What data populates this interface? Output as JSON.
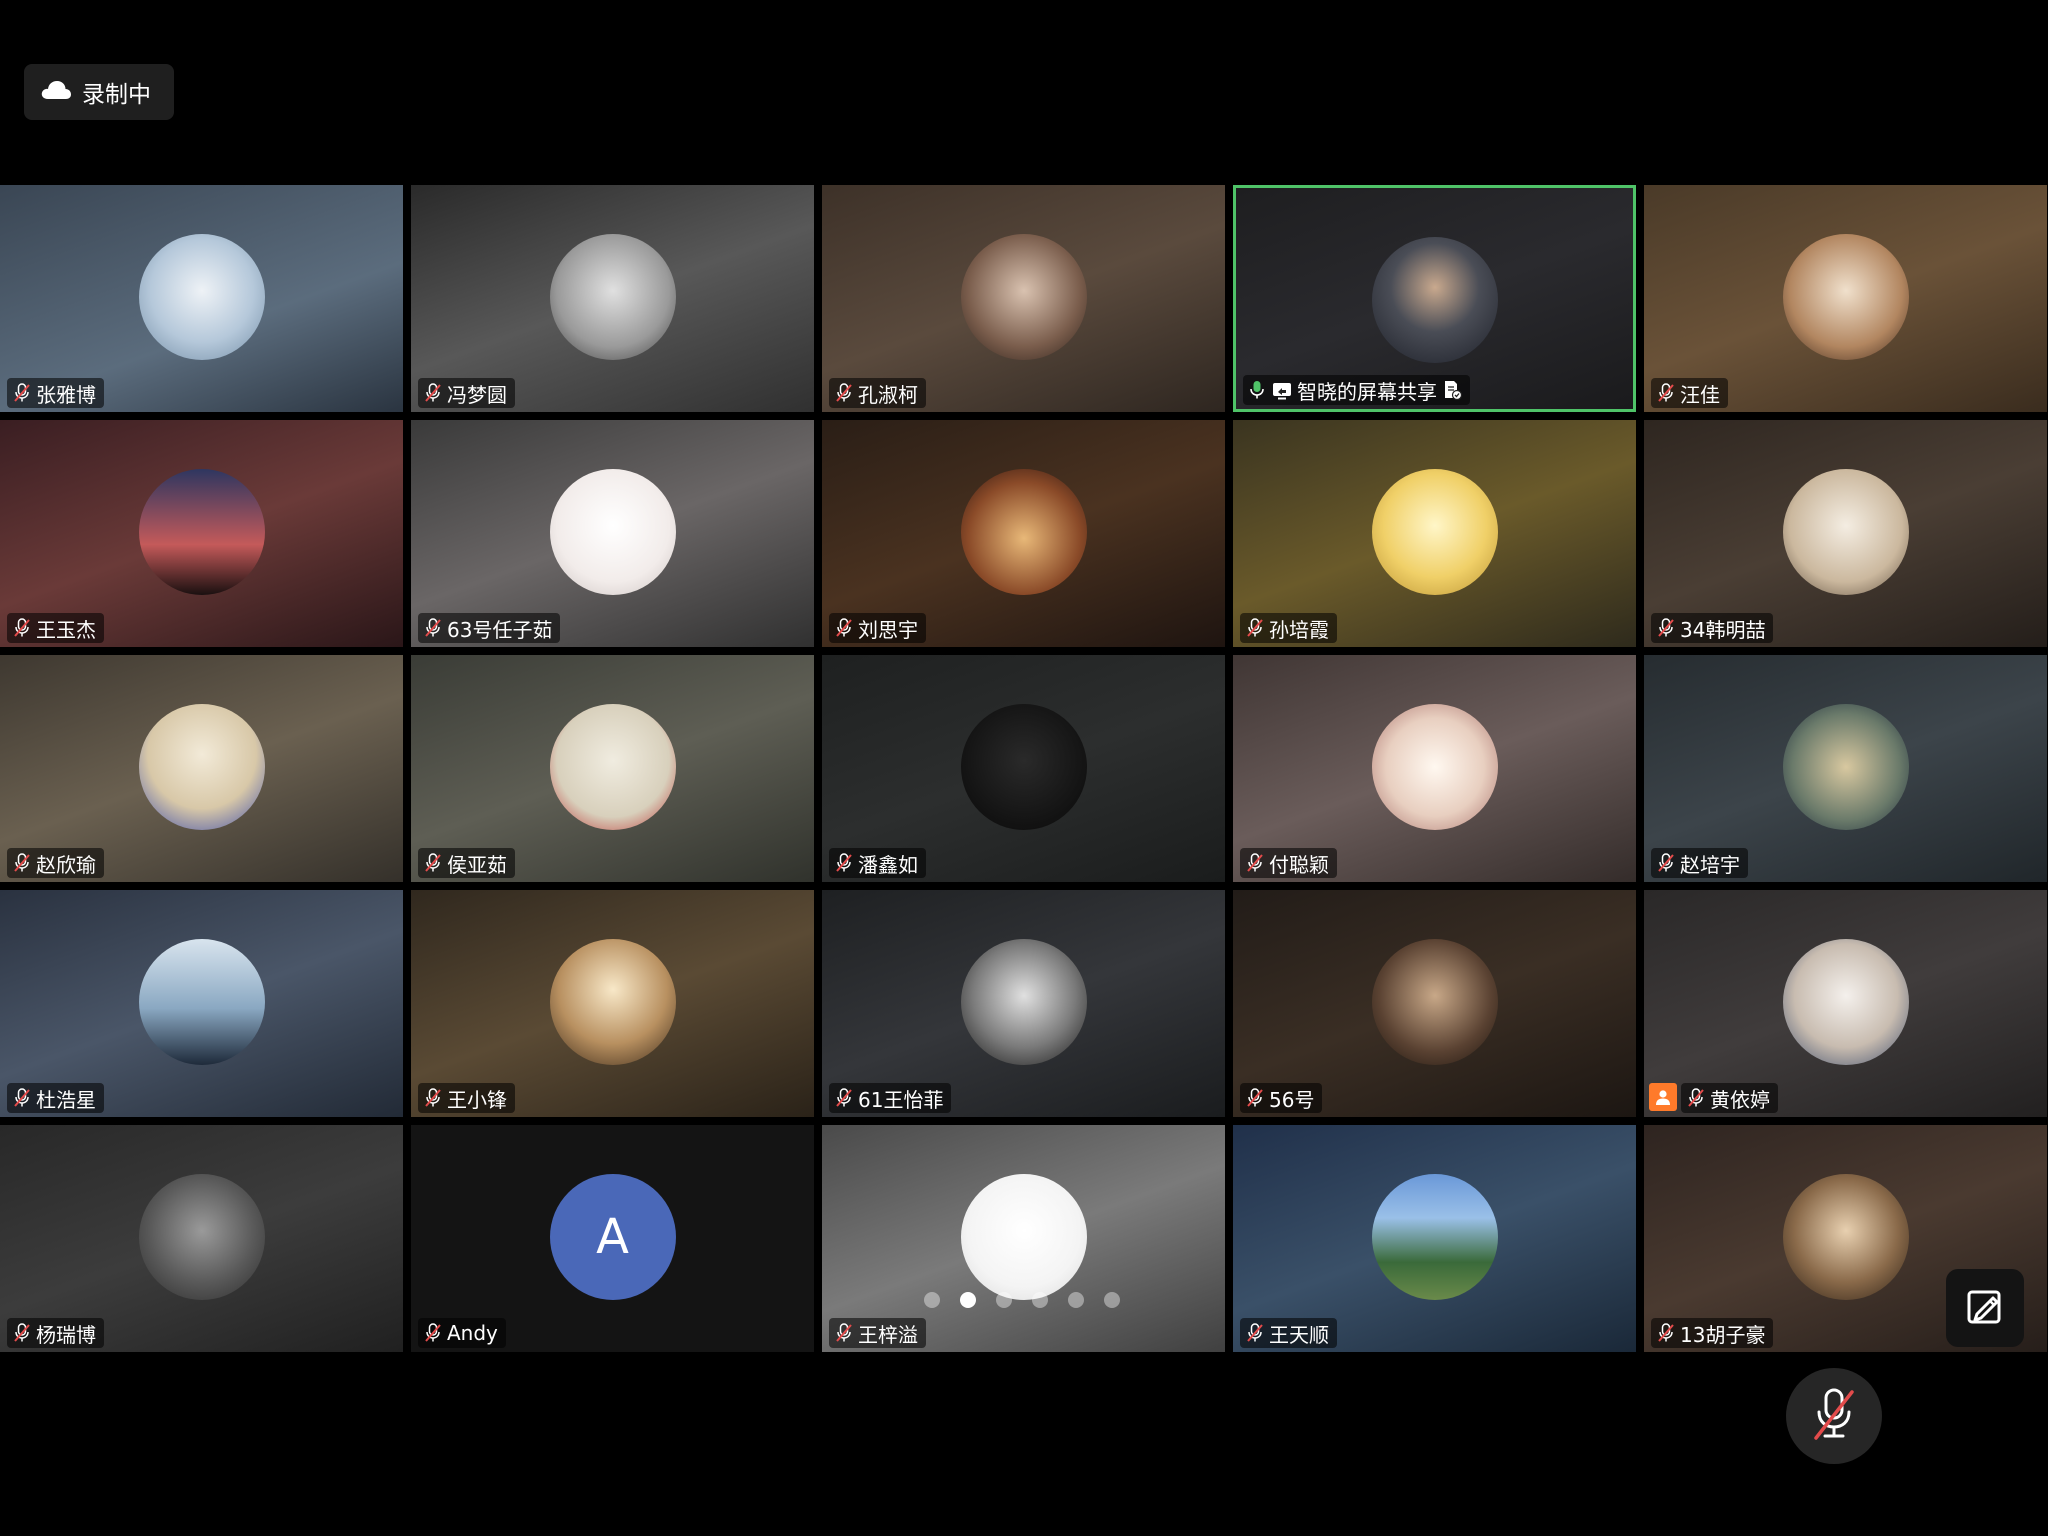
{
  "recording": {
    "label": "录制中",
    "icon": "cloud-icon"
  },
  "tiles": [
    {
      "name": "张雅博",
      "mic": "muted",
      "bg": "linear-gradient(160deg,#3a4654 0%,#5b6c7d 60%,#2a3440 100%)",
      "avatar": "radial-gradient(circle at 50% 45%,#eef2f6 0%,#b5c8da 55%,#6f8aa3 100%)"
    },
    {
      "name": "冯梦圆",
      "mic": "muted",
      "bg": "linear-gradient(160deg,#2a2a2a 0%,#585858 50%,#303030 100%)",
      "avatar": "radial-gradient(circle at 50% 45%,#e0e0e0 0%,#9a9a9a 60%,#3a3a3a 100%)"
    },
    {
      "name": "孔淑柯",
      "mic": "muted",
      "bg": "linear-gradient(160deg,#3d3128 0%,#5a4a3d 50%,#2e2620 100%)",
      "avatar": "radial-gradient(circle at 50% 45%,#d9c2b0 0%,#7a5d4c 60%,#2a1e18 100%)"
    },
    {
      "name": "智晓的屏幕共享",
      "mic": "active",
      "screen_share": true,
      "doc_icon": true,
      "active": true,
      "bg": "linear-gradient(160deg,#1e1e20 0%,#2a2a2e 50%,#1a1a1c 100%)",
      "avatar": "radial-gradient(circle at 50% 40%,#c9a98e 0%,#4a4d56 45%,#1c1f28 100%)"
    },
    {
      "name": "汪佳",
      "mic": "muted",
      "bg": "linear-gradient(160deg,#4a3a28 0%,#6a5238 50%,#3a2c1e 100%)",
      "avatar": "radial-gradient(circle at 50% 45%,#f0e0cc 0%,#b28660 60%,#3a2418 100%)"
    },
    {
      "name": "王玉杰",
      "mic": "muted",
      "bg": "linear-gradient(160deg,#3a1e22 0%,#6a3a38 50%,#2a1618 100%)",
      "avatar": "linear-gradient(180deg,#2e3660 0%,#c45a5a 60%,#1a1010 100%)"
    },
    {
      "name": "63号任子茹",
      "mic": "muted",
      "bg": "linear-gradient(160deg,#3a3a3a 0%,#6a6666 50%,#303030 100%)",
      "avatar": "radial-gradient(circle at 50% 45%,#ffffff 0%,#f2ecea 60%,#c9c0be 100%)"
    },
    {
      "name": "刘思宇",
      "mic": "muted",
      "bg": "linear-gradient(160deg,#2a1e16 0%,#4a3220 50%,#1e1410 100%)",
      "avatar": "radial-gradient(circle at 50% 55%,#e8b878 0%,#8a4a28 60%,#2a1410 100%)"
    },
    {
      "name": "孙培霞",
      "mic": "muted",
      "bg": "linear-gradient(160deg,#3a3420 0%,#6a5a2a 50%,#2e2a1c 100%)",
      "avatar": "radial-gradient(circle at 50% 45%,#fff6c8 0%,#f0d068 55%,#b89030 100%)"
    },
    {
      "name": "34韩明喆",
      "mic": "muted",
      "bg": "linear-gradient(160deg,#2e2620 0%,#4a3e34 50%,#241e1a 100%)",
      "avatar": "radial-gradient(circle at 50% 45%,#f4ede2 0%,#cbb89e 60%,#5a4a3a 100%)"
    },
    {
      "name": "赵欣瑜",
      "mic": "muted",
      "bg": "linear-gradient(160deg,#3e3830 0%,#6a6050 50%,#34302a 100%)",
      "avatar": "radial-gradient(circle at 50% 40%,#f2ead8 0%,#d8c8a8 55%,#3a4aa8 100%)"
    },
    {
      "name": "侯亚茹",
      "mic": "muted",
      "bg": "linear-gradient(160deg,#3a3c36 0%,#5e5e54 50%,#30322c 100%)",
      "avatar": "radial-gradient(circle at 50% 45%,#f0ece0 0%,#d8d0bc 60%,#b82a2a 100%)"
    },
    {
      "name": "潘鑫如",
      "mic": "muted",
      "bg": "linear-gradient(160deg,#1e2020 0%,#2c2e2e 50%,#1a1c1c 100%)",
      "avatar": "radial-gradient(circle at 50% 45%,#2a2a2a 0%,#121212 70%,#0a0a0a 100%)"
    },
    {
      "name": "付聪颖",
      "mic": "muted",
      "bg": "linear-gradient(160deg,#403634 0%,#6a5c5a 50%,#342c2a 100%)",
      "avatar": "radial-gradient(circle at 50% 50%,#fff8f0 0%,#e8cfc0 55%,#a8706a 100%)"
    },
    {
      "name": "赵培宇",
      "mic": "muted",
      "bg": "linear-gradient(160deg,#262c30 0%,#3c444a 50%,#20262a 100%)",
      "avatar": "radial-gradient(circle at 50% 50%,#d8c8a0 0%,#6a7a6a 60%,#1a2a3a 100%)"
    },
    {
      "name": "杜浩星",
      "mic": "muted",
      "bg": "linear-gradient(160deg,#2a3240 0%,#4a5668 50%,#222a36 100%)",
      "avatar": "linear-gradient(180deg,#d8e4ee 0%,#8aa8c2 55%,#1e2a3a 100%)"
    },
    {
      "name": "王小锋",
      "mic": "muted",
      "bg": "linear-gradient(160deg,#30281e 0%,#5a4a34 50%,#2a2218 100%)",
      "avatar": "radial-gradient(circle at 50% 40%,#f8e8c8 0%,#b89060 55%,#3a2818 100%)"
    },
    {
      "name": "61王怡菲",
      "mic": "muted",
      "bg": "linear-gradient(160deg,#1e2022 0%,#34363a 50%,#1a1c1e 100%)",
      "avatar": "radial-gradient(circle at 50% 45%,#e0e0e0 0%,#7a7a7a 55%,#141414 100%)"
    },
    {
      "name": "56号",
      "mic": "muted",
      "bg": "linear-gradient(160deg,#221c18 0%,#3a2e24 50%,#1c1612 100%)",
      "avatar": "radial-gradient(circle at 50% 45%,#c8a888 0%,#5a4232 60%,#1a120c 100%)"
    },
    {
      "name": "黄依婷",
      "mic": "muted",
      "host": true,
      "bg": "linear-gradient(160deg,#2a2828 0%,#403c3c 50%,#222020 100%)",
      "avatar": "radial-gradient(circle at 50% 45%,#f4f0ec 0%,#c8bcb0 55%,#3a4a6a 100%)"
    },
    {
      "name": "杨瑞博",
      "mic": "muted",
      "bg": "linear-gradient(160deg,#282828 0%,#3c3c3c 50%,#202020 100%)",
      "avatar": "radial-gradient(circle at 50% 45%,#9a9a9a 0%,#5a5a5a 55%,#2a2a2a 100%)"
    },
    {
      "name": "Andy",
      "mic": "muted",
      "bg": "#141414",
      "avatar": "#4a68b8",
      "letter": "A"
    },
    {
      "name": "王梓溢",
      "mic": "muted",
      "bg": "linear-gradient(160deg,#4a4a4a 0%,#7a7a7a 50%,#404040 100%)",
      "avatar": "radial-gradient(circle at 50% 45%,#ffffff 0%,#f4f4f4 60%,#d8d8d8 100%)"
    },
    {
      "name": "王天顺",
      "mic": "muted",
      "bg": "linear-gradient(160deg,#20304a 0%,#3a5068 50%,#1a2838 100%)",
      "avatar": "linear-gradient(180deg,#6a98d8 0%,#9ac0e8 35%,#3a6a3a 70%,#6a8a4a 100%)"
    },
    {
      "name": "13胡子豪",
      "mic": "muted",
      "bg": "linear-gradient(160deg,#2e2420 0%,#4a3a30 50%,#261e1a 100%)",
      "avatar": "radial-gradient(circle at 50% 45%,#e8d0b0 0%,#8a6a4a 55%,#2a1e14 100%)"
    }
  ],
  "pagination": {
    "count": 6,
    "current": 1
  },
  "controls": {
    "annotate_icon": "annotate-icon",
    "mute_icon": "mic-muted-icon"
  },
  "colors": {
    "active_border": "#4fc368",
    "mic_muted": "#e34b4b",
    "mic_active": "#4fc368",
    "host_badge": "#ff7a2a"
  }
}
